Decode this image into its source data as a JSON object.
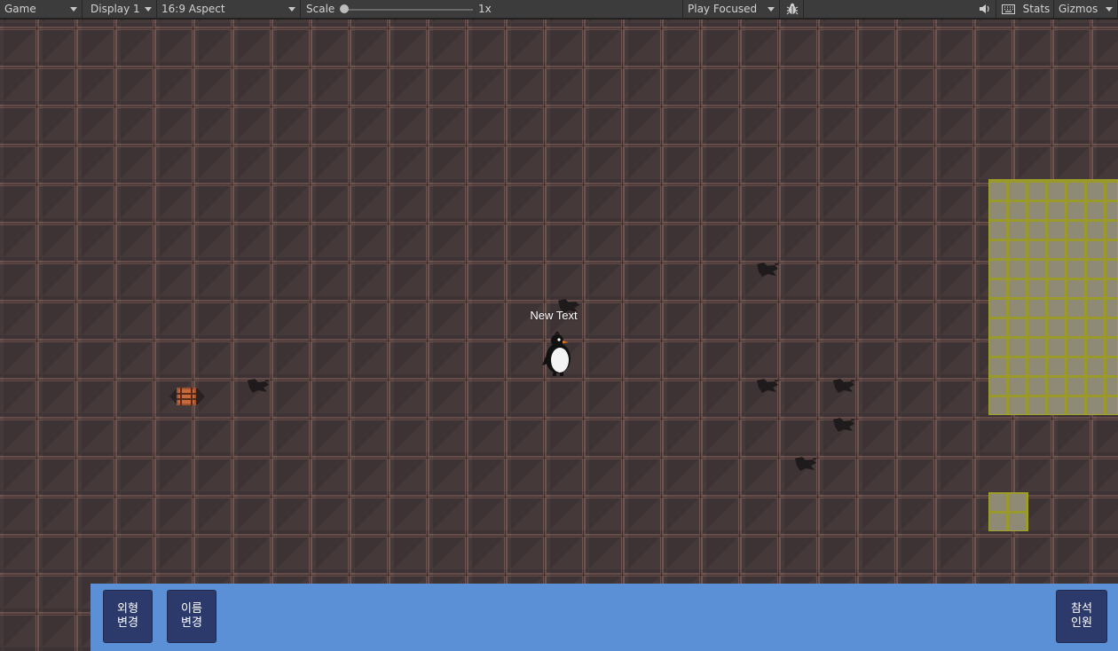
{
  "toolbar": {
    "view_dropdown": "Game",
    "display_dropdown": "Display 1",
    "aspect_dropdown": "16:9 Aspect",
    "scale_label": "Scale",
    "scale_value": "1x",
    "scale_level": 0.0,
    "play_mode_dropdown": "Play Focused",
    "stats_label": "Stats",
    "gizmos_label": "Gizmos"
  },
  "game": {
    "name_tag": "New Text",
    "buttons": {
      "change_look": [
        "외형",
        "변경"
      ],
      "change_name": [
        "이름",
        "변경"
      ],
      "attendees": [
        "참석",
        "인원"
      ]
    }
  },
  "colors": {
    "floor": "#45393a",
    "grid_lines": "#6e5551",
    "highlight_zone": "#8e8a75",
    "panel": "#5b8fd6",
    "button": "#2c3a6b"
  }
}
